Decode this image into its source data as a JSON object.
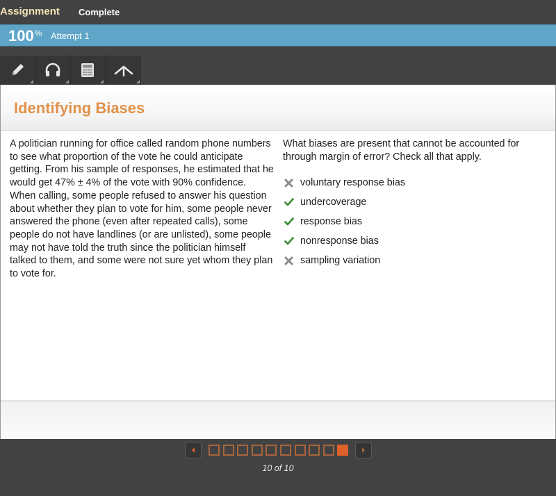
{
  "header": {
    "assignment_label": "Assignment",
    "status_label": "Complete"
  },
  "progress": {
    "score": "100",
    "score_unit": "%",
    "attempt_label": "Attempt 1"
  },
  "toolbar": {
    "tools": [
      {
        "name": "pencil",
        "icon": "pencil-icon"
      },
      {
        "name": "audio",
        "icon": "headphones-icon"
      },
      {
        "name": "calculator",
        "icon": "calculator-icon"
      },
      {
        "name": "reference",
        "icon": "caret-up-icon"
      }
    ]
  },
  "activity": {
    "title": "Identifying Biases",
    "passage": "A politician running for office called random phone numbers to see what proportion of the vote he could anticipate getting. From his sample of responses, he estimated that he would get 47% ± 4% of the vote with 90% confidence. When calling, some people refused to answer his question about whether they plan to vote for him, some people never answered the phone (even after repeated calls), some people do not have landlines (or are unlisted), some people may not have told the truth since the politician himself talked to them, and some were not sure yet whom they plan to vote for.",
    "question": "What biases are present that cannot be accounted for through margin of error? Check all that apply.",
    "options": [
      {
        "label": "voluntary response bias",
        "state": "incorrect",
        "icon": "x-mark-icon"
      },
      {
        "label": "undercoverage",
        "state": "correct",
        "icon": "checkmark-icon"
      },
      {
        "label": "response bias",
        "state": "correct",
        "icon": "checkmark-icon"
      },
      {
        "label": "nonresponse bias",
        "state": "correct",
        "icon": "checkmark-icon"
      },
      {
        "label": "sampling variation",
        "state": "incorrect",
        "icon": "x-mark-icon"
      }
    ]
  },
  "pager": {
    "current": 10,
    "total": 10,
    "label": "10 of 10"
  },
  "colors": {
    "title": "#e0914a",
    "progress_bar": "#5ea5c8",
    "correct": "#3f8f3a",
    "incorrect": "#8a8a8a",
    "active_page": "#e0602a"
  }
}
